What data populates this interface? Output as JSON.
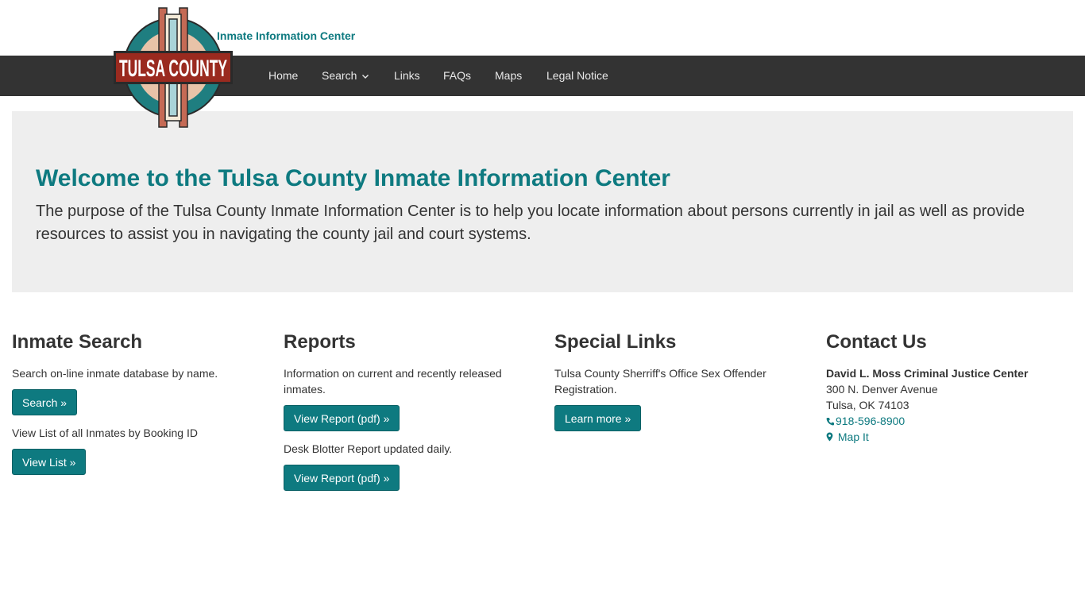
{
  "header": {
    "subtitle": "Inmate Information Center",
    "logo_text": "TULSA COUNTY"
  },
  "nav": {
    "home": "Home",
    "search": "Search",
    "links": "Links",
    "faqs": "FAQs",
    "maps": "Maps",
    "legal": "Legal Notice"
  },
  "jumbotron": {
    "title": "Welcome to the Tulsa County Inmate Information Center",
    "body": "The purpose of the Tulsa County Inmate Information Center is to help you locate information about persons currently in jail as well as provide resources to assist you in navigating the county jail and court systems."
  },
  "inmate_search": {
    "heading": "Inmate Search",
    "desc1": "Search on-line inmate database by name.",
    "button1": "Search »",
    "desc2": "View List of all Inmates by Booking ID",
    "button2": "View List »"
  },
  "reports": {
    "heading": "Reports",
    "desc1": "Information on current and recently released inmates.",
    "button1": "View Report (pdf) »",
    "desc2": "Desk Blotter Report updated daily.",
    "button2": "View Report (pdf) »"
  },
  "special_links": {
    "heading": "Special Links",
    "desc1": "Tulsa County Sherriff's Office Sex Offender Registration.",
    "button1": "Learn more »"
  },
  "contact": {
    "heading": "Contact Us",
    "name": "David L. Moss Criminal Justice Center",
    "address1": "300 N. Denver Avenue",
    "address2": "Tulsa, OK 74103",
    "phone": "918-596-8900",
    "map": "Map It"
  },
  "colors": {
    "accent": "#0e7a80",
    "navbar": "#333333",
    "jumbotron": "#eeeeee"
  }
}
